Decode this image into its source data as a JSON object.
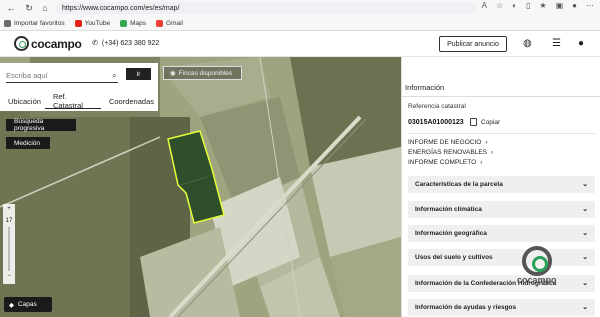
{
  "browser": {
    "url": "https://www.cocampo.com/es/es/map/",
    "bookmarks": [
      {
        "label": "Importar favoritos",
        "color": "#6b6b6b"
      },
      {
        "label": "YouTube",
        "color": "#e62117"
      },
      {
        "label": "Maps",
        "color": "#34a853"
      },
      {
        "label": "Gmail",
        "color": "#ea4335"
      }
    ]
  },
  "header": {
    "logo_text": "cocampo",
    "phone": "(+34) 623 380 922",
    "publish_label": "Publicar anuncio"
  },
  "search": {
    "placeholder": "Escriba aquí",
    "go_label": "Ir",
    "tabs": [
      "Ubicación",
      "Ref. Catastral",
      "Coordenadas"
    ],
    "active_tab": "Ref. Catastral"
  },
  "map": {
    "progressive_search_label": "Búsqueda progresiva",
    "measure_label": "Medición",
    "fincas_label": "Fincas disponibles",
    "zoom_in": "+",
    "zoom_level": "17",
    "zoom_out": "−",
    "layers_label": "Capas"
  },
  "info": {
    "tab_label": "Información",
    "ref_label": "Referencia catastral",
    "ref_value": "03015A01000123",
    "copy_label": "Copiar",
    "links": [
      "INFORME DE NEGOCIO",
      "ENERGÍAS RENOVABLES",
      "INFORME COMPLETO"
    ],
    "accordions": [
      "Características de la parcela",
      "Información climática",
      "Información geográfica",
      "Usos del suelo y cultivos",
      "Información de la Confederación Hidrográfica",
      "Información de ayudas y riesgos"
    ],
    "watermark_text": "cocampo"
  },
  "colors": {
    "accent_green": "#2e9e5b",
    "parcel_highlight": "#e5ff3a",
    "dark_button": "#1a1a1a"
  }
}
